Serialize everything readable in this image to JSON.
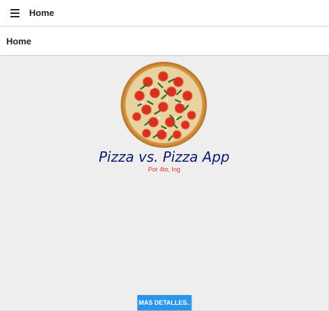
{
  "appbar": {
    "menu_icon": "hamburger-menu-icon",
    "title": "Home"
  },
  "page_header": {
    "title": "Home"
  },
  "main": {
    "image": "pizza-image",
    "title": "Pizza vs. Pizza App",
    "subtitle": "Por 4to, Ing",
    "more_button_label": "MAS DETALLES.."
  },
  "colors": {
    "title": "#0b1a6e",
    "subtitle": "#e0322a",
    "button": "#2b95e9",
    "background": "#eeeeee"
  }
}
